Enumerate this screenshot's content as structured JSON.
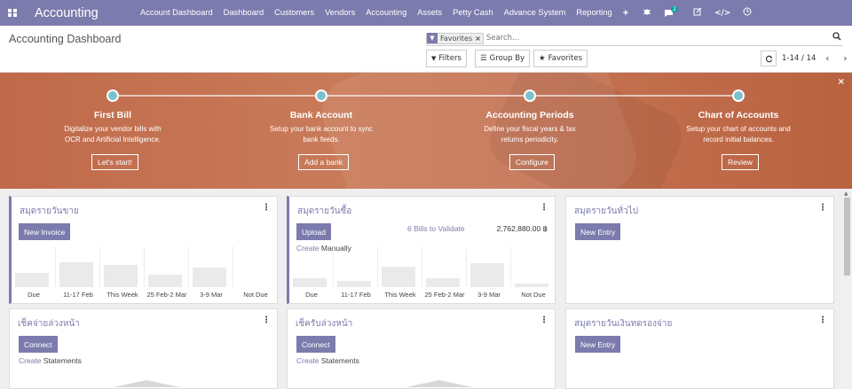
{
  "navbar": {
    "brand": "Accounting",
    "menu": [
      "Account Dashboard",
      "Dashboard",
      "Customers",
      "Vendors",
      "Accounting",
      "Assets",
      "Petty Cash",
      "Advance System",
      "Reporting"
    ],
    "plus_label": "+",
    "messages_count": "2",
    "colors": {
      "navbar": "#7c7bad",
      "badge": "#00a09d"
    }
  },
  "control": {
    "title": "Accounting Dashboard",
    "search_facet": "Favorites",
    "search_placeholder": "Search...",
    "filters_label": "Filters",
    "groupby_label": "Group By",
    "favorites_label": "Favorites",
    "pager": "1-14 / 14"
  },
  "onboarding": {
    "steps": [
      {
        "title": "First Bill",
        "desc1": "Digitalize your vendor bills with",
        "desc2": "OCR and Artificial Intelligence.",
        "button": "Let's start!"
      },
      {
        "title": "Bank Account",
        "desc1": "Setup your bank account to sync",
        "desc2": "bank feeds.",
        "button": "Add a bank"
      },
      {
        "title": "Accounting Periods",
        "desc1": "Define your fiscal years & tax",
        "desc2": "returns periodicity.",
        "button": "Configure"
      },
      {
        "title": "Chart of Accounts",
        "desc1": "Setup your chart of accounts and",
        "desc2": "record initial balances.",
        "button": "Review"
      }
    ]
  },
  "cards": {
    "sales": {
      "title": "สมุดรายวันขาย",
      "button": "New Invoice",
      "labels": [
        "Due",
        "11-17 Feb",
        "This Week",
        "25 Feb-2 Mar",
        "3-9 Mar",
        "Not Due"
      ],
      "values": [
        0.35,
        0.6,
        0.55,
        0.3,
        0.48,
        0
      ]
    },
    "purchase": {
      "title": "สมุดรายวันซื้อ",
      "button": "Upload",
      "create": "Create",
      "manually": "Manually",
      "validate": "6 Bills to Validate",
      "amount": "2,762,880.00 ฿",
      "labels": [
        "Due",
        "11-17 Feb",
        "This Week",
        "25 Feb-2 Mar",
        "3-9 Mar",
        "Not Due"
      ],
      "values": [
        0.22,
        0.15,
        0.5,
        0.22,
        0.58,
        0.08
      ]
    },
    "general": {
      "title": "สมุดรายวันทั่วไป",
      "button": "New Entry"
    },
    "cheque_out": {
      "title": "เช็คจ่ายล่วงหน้า",
      "button": "Connect",
      "create": "Create",
      "statements": "Statements"
    },
    "cheque_in": {
      "title": "เช็ครับล่วงหน้า",
      "button": "Connect",
      "create": "Create",
      "statements": "Statements"
    },
    "petty": {
      "title": "สมุดรายวันเงินทดรองจ่าย",
      "button": "New Entry"
    }
  }
}
